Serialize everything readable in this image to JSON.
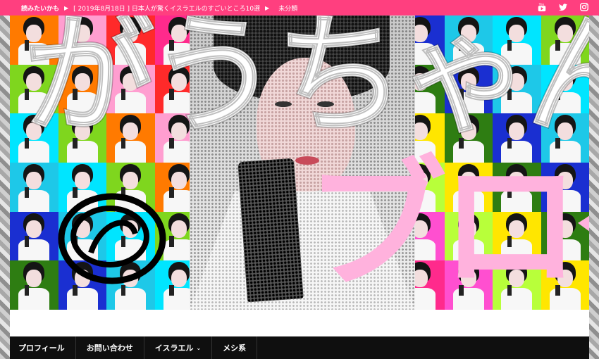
{
  "topbar": {
    "ticker_label": "読みたいかも",
    "ticker_item": "[ 2019年8月18日 ]  日本人が驚くイスラエルのすごいところ10選",
    "ticker_category": "未分類",
    "social": [
      "youtube-icon",
      "twitter-icon",
      "instagram-icon"
    ],
    "background": "#ff3f7f"
  },
  "banner": {
    "title_main": "がうちゃん",
    "title_sub": "ブログ",
    "tile_colors": [
      "#ff7a00",
      "#2e7d12",
      "#ff2a2a",
      "#1ec8e8",
      "#ff4fd0",
      "#7fd61e",
      "#ffe600",
      "#ff9ed0",
      "#1a2fd1",
      "#ff2a8c",
      "#00e5ff",
      "#b8ff3a"
    ]
  },
  "nav": {
    "items": [
      {
        "label": "プロフィール"
      },
      {
        "label": "お問い合わせ"
      },
      {
        "label": "イスラエル",
        "has_dropdown": true
      },
      {
        "label": "メシ系"
      }
    ]
  }
}
